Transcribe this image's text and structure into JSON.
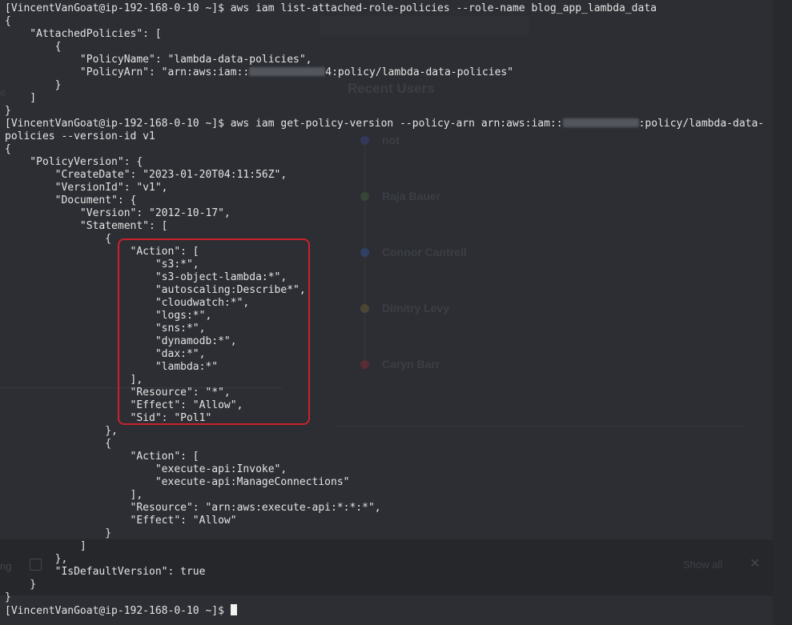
{
  "terminal": {
    "prompt": "[VincentVanGoat@ip-192-168-0-10 ~]$",
    "cmd1": "aws iam list-attached-role-policies --role-name blog_app_lambda_data",
    "out1": [
      "{",
      "    \"AttachedPolicies\": [",
      "        {",
      "            \"PolicyName\": \"lambda-data-policies\","
    ],
    "arn1_prefix": "            \"PolicyArn\": \"arn:aws:iam::",
    "arn1_suffix": "4:policy/lambda-data-policies\"",
    "out1_end": [
      "        }",
      "    ]",
      "}"
    ],
    "cmd2_prefix": "aws iam get-policy-version --policy-arn arn:aws:iam::",
    "cmd2_suffix": ":policy/lambda-data-",
    "cmd2_wrap": "policies --version-id v1",
    "out2": [
      "{",
      "    \"PolicyVersion\": {",
      "        \"CreateDate\": \"2023-01-20T04:11:56Z\",",
      "        \"VersionId\": \"v1\",",
      "        \"Document\": {",
      "            \"Version\": \"2012-10-17\",",
      "            \"Statement\": [",
      "                {",
      "                    \"Action\": [",
      "                        \"s3:*\",",
      "                        \"s3-object-lambda:*\",",
      "                        \"autoscaling:Describe*\",",
      "                        \"cloudwatch:*\",",
      "                        \"logs:*\",",
      "                        \"sns:*\",",
      "                        \"dynamodb:*\",",
      "                        \"dax:*\",",
      "                        \"lambda:*\"",
      "                    ],",
      "                    \"Resource\": \"*\",",
      "                    \"Effect\": \"Allow\",",
      "                    \"Sid\": \"Pol1\"",
      "                },",
      "                {",
      "                    \"Action\": [",
      "                        \"execute-api:Invoke\",",
      "                        \"execute-api:ManageConnections\"",
      "                    ],",
      "                    \"Resource\": \"arn:aws:execute-api:*:*:*\",",
      "                    \"Effect\": \"Allow\"",
      "                }",
      "            ]",
      "        },",
      "        \"IsDefaultVersion\": true",
      "    }",
      "}"
    ]
  },
  "background": {
    "heading": "Recent Users",
    "users": [
      "not",
      "Raja Bauer",
      "Connor Cantrell",
      "Dimitry Levy",
      "Caryn Barr"
    ],
    "user_dot_colors": [
      "#3a3f7a",
      "#3f5a3a",
      "#34508a",
      "#6a5a33",
      "#7a2e37"
    ],
    "show_all": "Show all",
    "close_glyph": "✕",
    "partial_left": "ng",
    "partial_sidebar": "e"
  },
  "colors": {
    "terminal_text": "#e4e4e4",
    "terminal_bg": "#2c2e33",
    "highlight_border": "#c8232b"
  }
}
